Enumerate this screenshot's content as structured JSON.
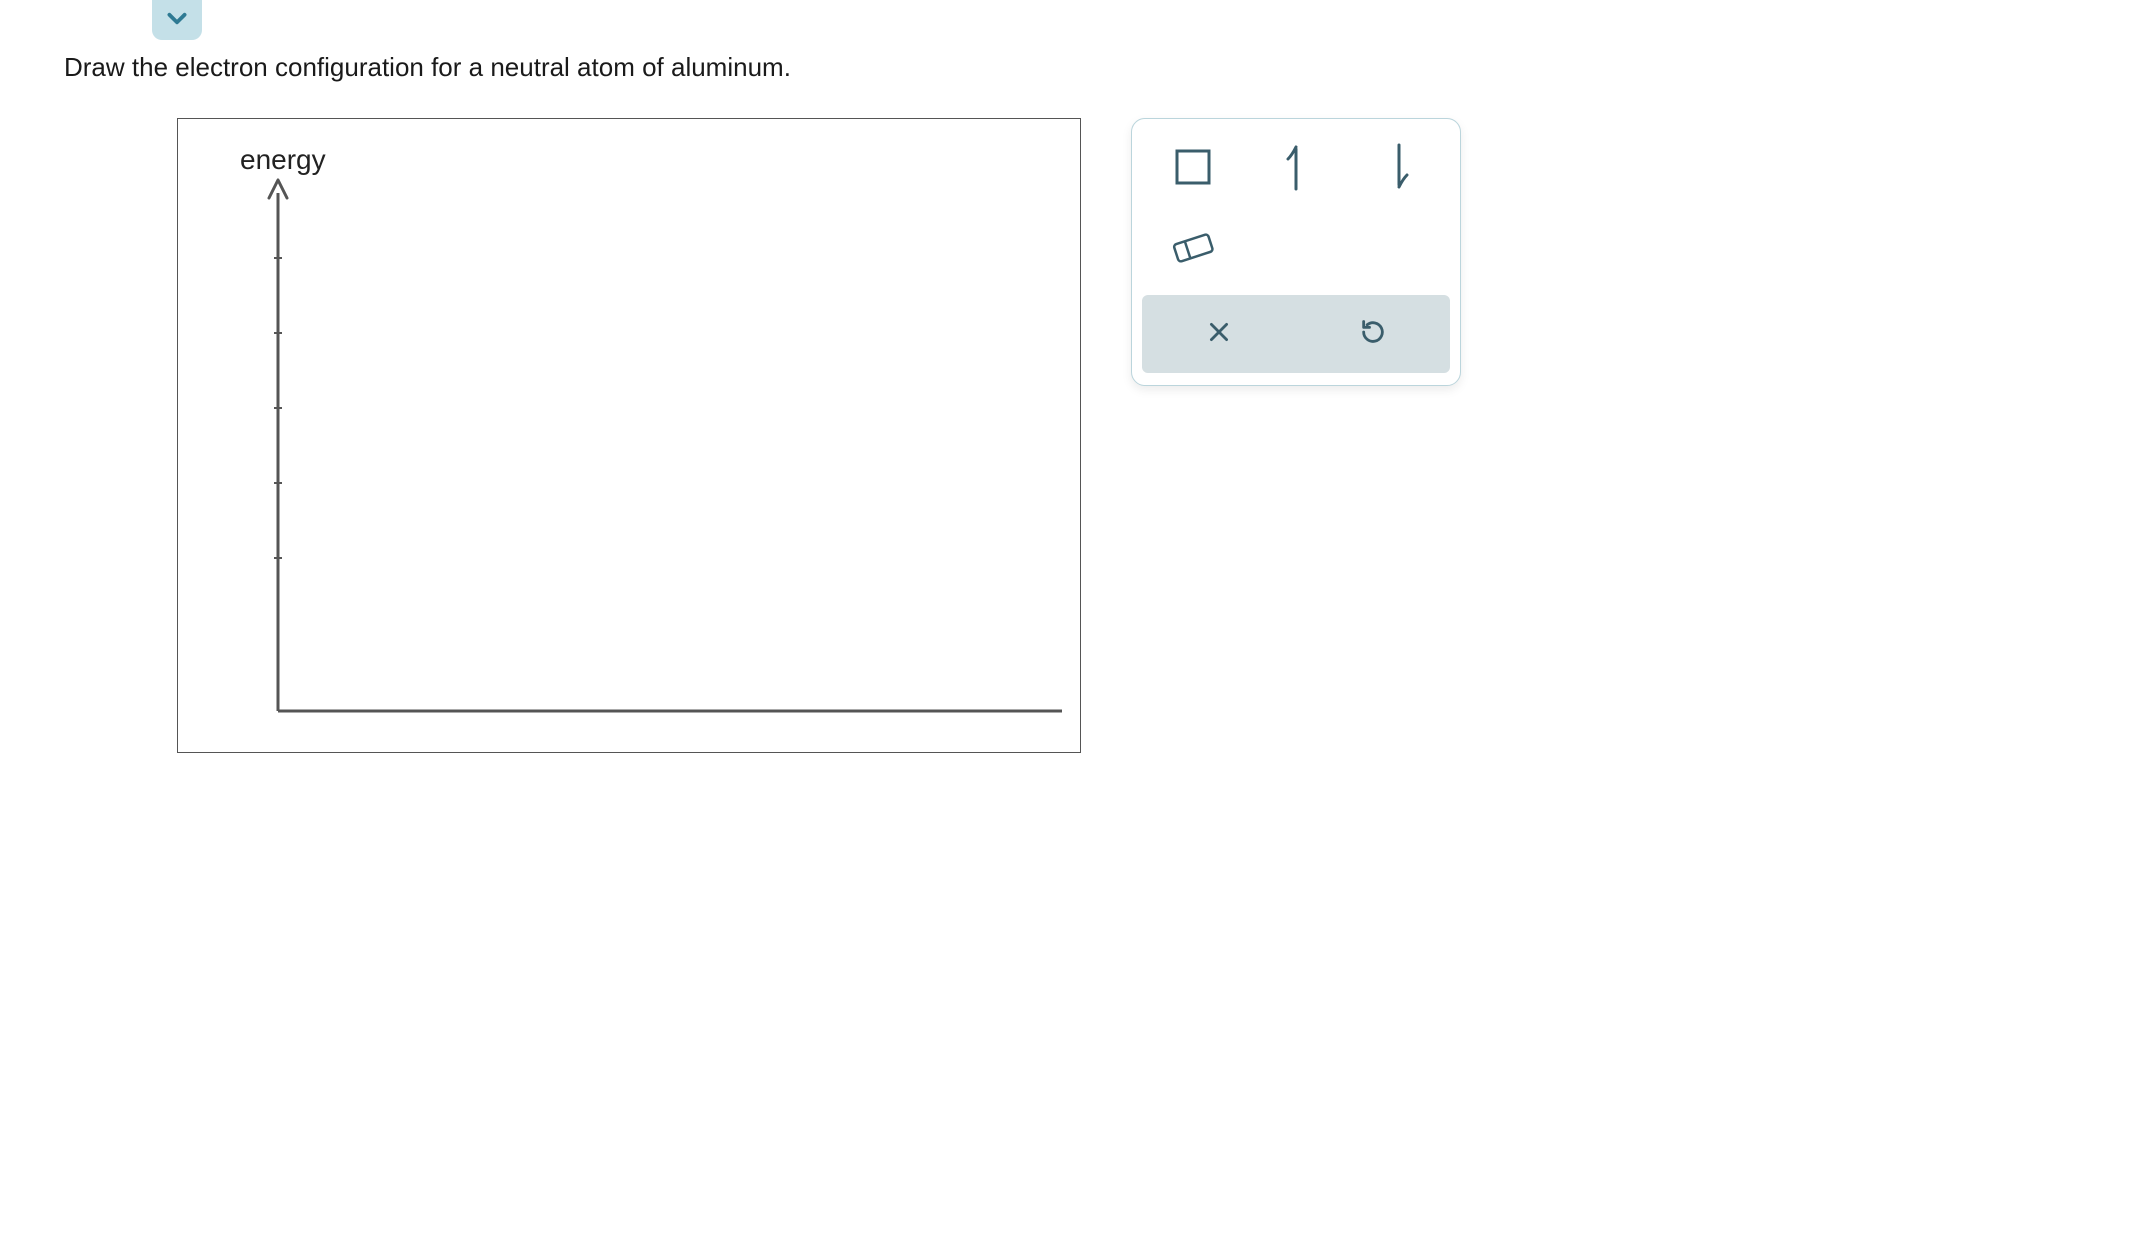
{
  "header": {
    "expand_icon": "chevron-down"
  },
  "question": {
    "prompt": "Draw the electron configuration for a neutral atom of aluminum."
  },
  "canvas": {
    "axis_label": "energy"
  },
  "tools": {
    "row1": {
      "box": "orbital-box",
      "up": "spin-up-arrow",
      "down": "spin-down-arrow"
    },
    "row2": {
      "eraser": "eraser"
    },
    "bottom": {
      "clear": "clear-x",
      "reset": "reset-undo"
    }
  },
  "colors": {
    "tool_stroke": "#3a5d6b",
    "axis_stroke": "#555555",
    "panel_border": "#bbd5dc",
    "bottom_bg": "#d5dfe2",
    "expand_bg": "#c4e0e8"
  }
}
